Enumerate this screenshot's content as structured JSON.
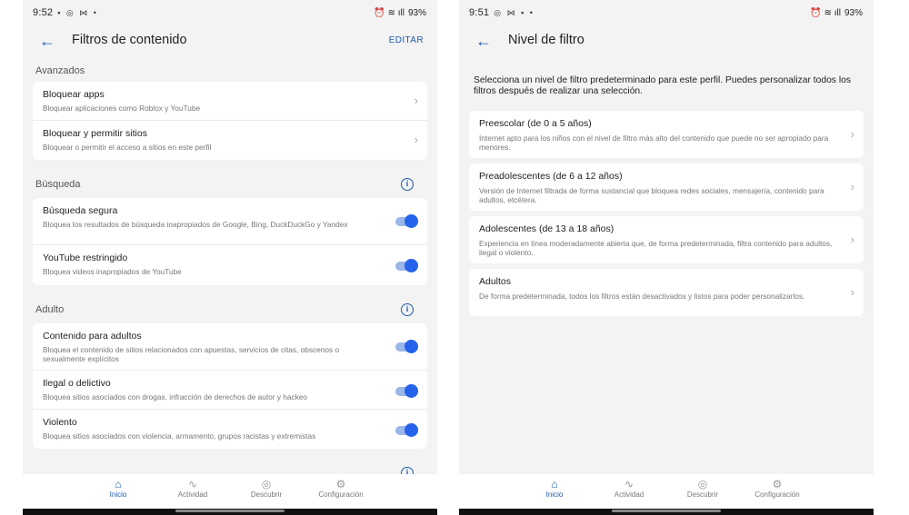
{
  "left": {
    "status": {
      "time": "9:52",
      "icons": "▪ ◎ ⋈ •",
      "right_icons": "⏰ ≋ ıll",
      "battery": "93%"
    },
    "title": "Filtros de contenido",
    "edit_label": "EDITAR",
    "sections": {
      "avanzados": {
        "label": "Avanzados",
        "rows": [
          {
            "title": "Bloquear apps",
            "subtitle": "Bloquear aplicaciones como Roblox y YouTube"
          },
          {
            "title": "Bloquear y permitir sitios",
            "subtitle": "Bloquear o permitir el acceso a sitios en este perfil"
          }
        ]
      },
      "busqueda": {
        "label": "Búsqueda",
        "rows": [
          {
            "title": "Búsqueda segura",
            "subtitle": "Bloquea los resultados de búsqueda inapropiados de Google, Bing, DuckDuckGo y Yandex",
            "toggle_on": true
          },
          {
            "title": "YouTube restringido",
            "subtitle": "Bloquea videos inapropiados de YouTube",
            "toggle_on": true
          }
        ]
      },
      "adulto": {
        "label": "Adulto",
        "rows": [
          {
            "title": "Contenido para adultos",
            "subtitle": "Bloquea el contenido de sitios relacionados con apuestas, servicios de citas, obscenos o sexualmente explícitos",
            "toggle_on": true
          },
          {
            "title": "Ilegal o delictivo",
            "subtitle": "Bloquea sitios asociados con drogas, infracción de derechos de autor y hackeo",
            "toggle_on": true
          },
          {
            "title": "Violento",
            "subtitle": "Bloquea sitios asociados con violencia, armamento, grupos racistas y extremistas",
            "toggle_on": true
          }
        ]
      }
    }
  },
  "right": {
    "status": {
      "time": "9:51",
      "icons": "◎ ⋈ ▪ •",
      "right_icons": "⏰ ≋ ıll",
      "battery": "93%"
    },
    "title": "Nivel de filtro",
    "intro": "Selecciona un nivel de filtro predeterminado para este perfil. Puedes personalizar todos los filtros después de realizar una selección.",
    "levels": [
      {
        "title": "Preescolar (de 0 a 5 años)",
        "subtitle": "Internet apto para los niños con el nivel de filtro más alto del contenido que puede no ser apropiado para menores."
      },
      {
        "title": "Preadolescentes (de 6 a 12 años)",
        "subtitle": "Versión de Internet filtrada de forma sustancial que bloquea redes sociales, mensajería, contenido para adultos, etcétera."
      },
      {
        "title": "Adolescentes (de 13 a 18 años)",
        "subtitle": "Experiencia en línea moderadamente abierta que, de forma predeterminada, filtra contenido para adultos, ilegal o violento."
      },
      {
        "title": "Adultos",
        "subtitle": "De forma predeterminada, todos los filtros están desactivados y listos para poder personalizarlos."
      }
    ]
  },
  "nav": [
    {
      "label": "Inicio",
      "icon": "home-icon",
      "active": true
    },
    {
      "label": "Actividad",
      "icon": "activity-icon"
    },
    {
      "label": "Descubrir",
      "icon": "compass-icon"
    },
    {
      "label": "Configuración",
      "icon": "gear-icon"
    }
  ],
  "colors": {
    "accent": "#1e5bb0",
    "toggle": "#2563eb",
    "background": "#f3f3f3"
  }
}
